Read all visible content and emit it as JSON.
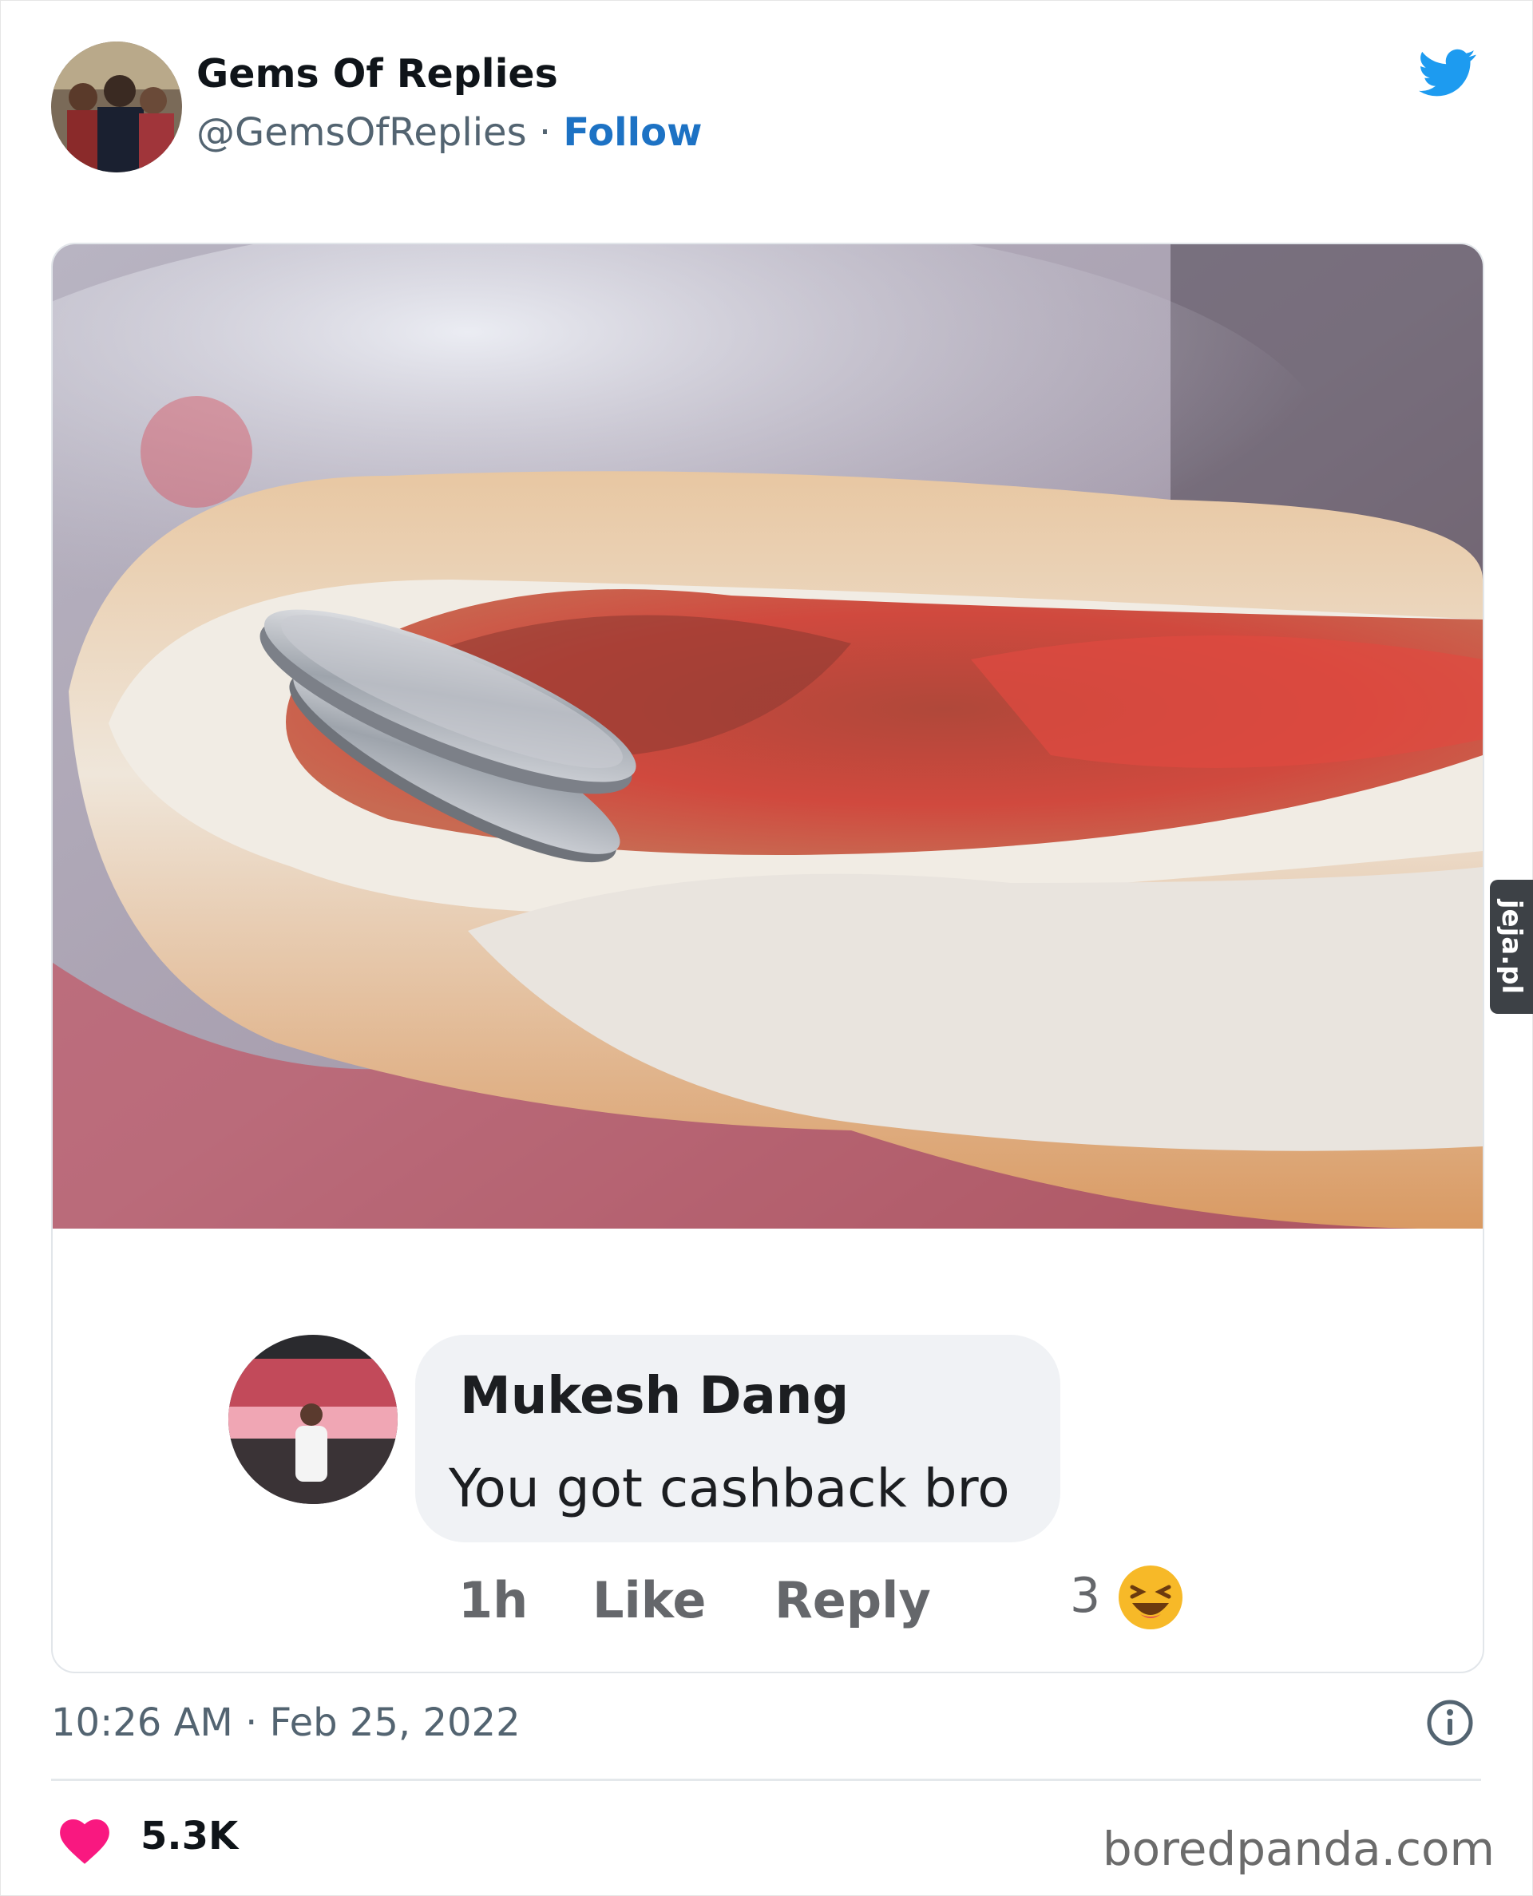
{
  "tweet": {
    "author_name": "Gems Of Replies",
    "handle": "@GemsOfReplies",
    "separator": " · ",
    "follow_label": "Follow",
    "timestamp": "10:26 AM · Feb 25, 2022",
    "likes": "5.3K"
  },
  "comment": {
    "author": "Mukesh Dang",
    "text": "You got cashback bro",
    "time": "1h",
    "like_label": "Like",
    "reply_label": "Reply",
    "reaction_count": "3"
  },
  "watermark": "jeja.pl",
  "source": "boredpanda.com",
  "colors": {
    "link": "#1d72c4",
    "twitter_blue": "#1d9bf0",
    "heart": "#f91880",
    "muted": "#536471"
  },
  "icons": [
    "twitter-bird-icon",
    "info-icon",
    "heart-icon",
    "laugh-emoji-icon"
  ]
}
